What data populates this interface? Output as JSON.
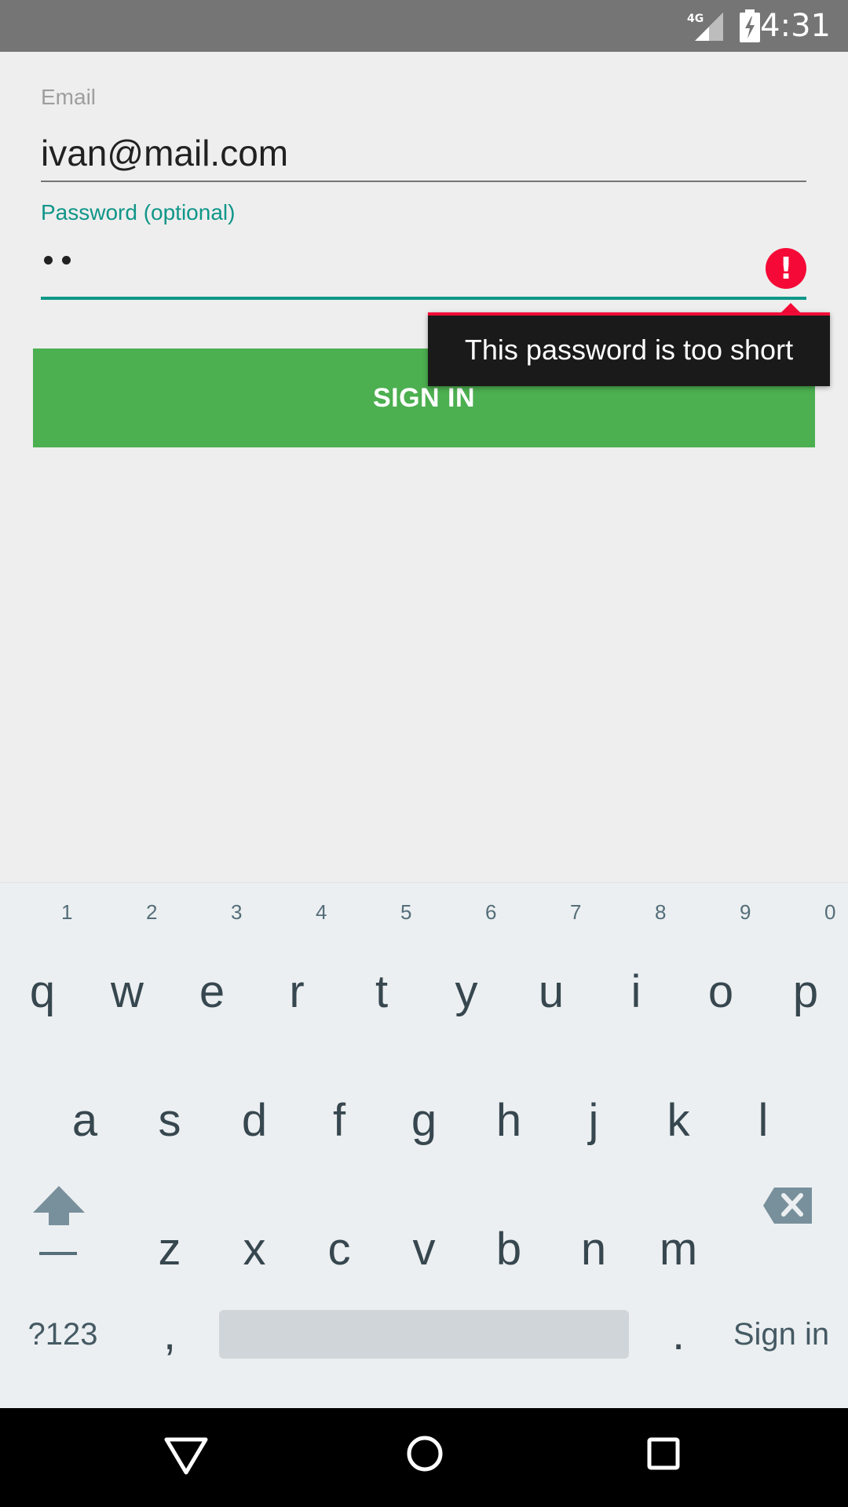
{
  "status_bar": {
    "network": "4G",
    "time": "4:31"
  },
  "form": {
    "email_label": "Email",
    "email_value": "ivan@mail.com",
    "password_label": "Password (optional)",
    "password_mask": "••",
    "error_message": "This password is too short",
    "sign_in_label": "SIGN IN"
  },
  "keyboard": {
    "row1": [
      "q",
      "w",
      "e",
      "r",
      "t",
      "y",
      "u",
      "i",
      "o",
      "p"
    ],
    "row1_hints": [
      "1",
      "2",
      "3",
      "4",
      "5",
      "6",
      "7",
      "8",
      "9",
      "0"
    ],
    "row2": [
      "a",
      "s",
      "d",
      "f",
      "g",
      "h",
      "j",
      "k",
      "l"
    ],
    "row3": [
      "z",
      "x",
      "c",
      "v",
      "b",
      "n",
      "m"
    ],
    "symbols_label": "?123",
    "comma_label": ",",
    "period_label": ".",
    "action_label": "Sign in"
  },
  "colors": {
    "accent": "#0f9688",
    "error": "#f50a37",
    "button": "#4caf50"
  }
}
